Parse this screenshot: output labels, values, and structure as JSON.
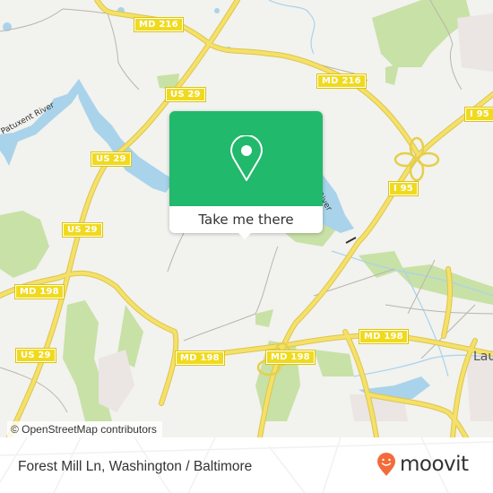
{
  "map": {
    "colors": {
      "land": "#f2f2ef",
      "water": "#a9d3ea",
      "park": "#c8e1a6",
      "urban": "#ebe5e3",
      "road_major": "#f5e06a",
      "road_minor": "#b9b5ad",
      "popup_green": "#21b96b",
      "brand_orange": "#f26b3a"
    },
    "shields": [
      {
        "label": "MD 216"
      },
      {
        "label": "MD 216"
      },
      {
        "label": "US 29"
      },
      {
        "label": "US 29"
      },
      {
        "label": "US 29"
      },
      {
        "label": "I 95"
      },
      {
        "label": "I 95"
      },
      {
        "label": "MD 198"
      },
      {
        "label": "MD 198"
      },
      {
        "label": "MD 198"
      },
      {
        "label": "MD 198"
      },
      {
        "label": "US 29"
      },
      {
        "label": "MD 198"
      }
    ],
    "labels": {
      "patuxent_river": "Patuxent River",
      "river_fragment": "River",
      "laurel": "Lau"
    },
    "attribution": "© OpenStreetMap contributors"
  },
  "popup": {
    "icon": "map-pin-icon",
    "action_label": "Take me there"
  },
  "footer": {
    "location_title": "Forest Mill Ln, Washington / Baltimore",
    "brand_name": "moovit",
    "brand_icon": "moovit-smiley-pin-icon"
  }
}
